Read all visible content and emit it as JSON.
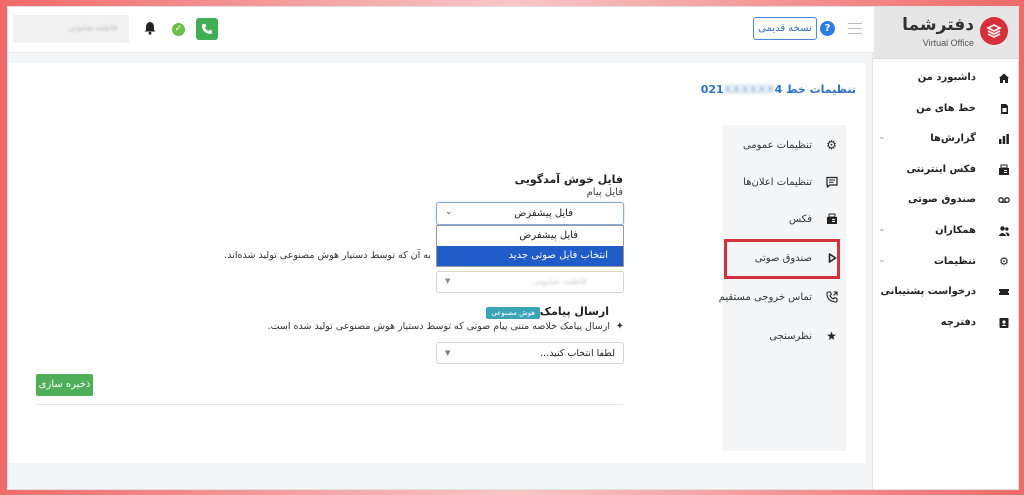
{
  "brand": {
    "name": "دفترشما",
    "subtitle": "Virtual Office",
    "accent": "#d8303a"
  },
  "sidebar": {
    "items": [
      {
        "label": "داشبورد من",
        "icon": "home-icon",
        "has_chevron": false
      },
      {
        "label": "خط های من",
        "icon": "sim-card-icon",
        "has_chevron": false
      },
      {
        "label": "گزارش‌ها",
        "icon": "chart-icon",
        "has_chevron": true
      },
      {
        "label": "فکس اینترنتی",
        "icon": "fax-icon",
        "has_chevron": false
      },
      {
        "label": "صندوق صوتی",
        "icon": "voicemail-icon",
        "has_chevron": false
      },
      {
        "label": "همکاران",
        "icon": "users-icon",
        "has_chevron": true
      },
      {
        "label": "تنظیمات",
        "icon": "gear-icon",
        "has_chevron": true
      },
      {
        "label": "درخواست پشتیبانی",
        "icon": "ticket-icon",
        "has_chevron": false
      },
      {
        "label": "دفترچه",
        "icon": "contact-book-icon",
        "has_chevron": false
      }
    ]
  },
  "topbar": {
    "old_version_label": "نسخه قدیمی",
    "help_label": "?",
    "user_placeholder": "قاطمه صابونی"
  },
  "page": {
    "title_prefix": "تنظیمات خط",
    "title_number_visible": "021",
    "title_number_blurred": "XXXXXX",
    "title_number_end": "4"
  },
  "settings_menu": {
    "items": [
      {
        "label": "تنظیمات عمومی",
        "icon": "gear-icon"
      },
      {
        "label": "تنظیمات اعلان‌ها",
        "icon": "message-icon"
      },
      {
        "label": "فکس",
        "icon": "fax-icon"
      },
      {
        "label": "صندوق صوتی",
        "icon": "play-icon"
      },
      {
        "label": "تماس خروجی مستقیم",
        "icon": "phone-forward-icon"
      },
      {
        "label": "نظرسنجی",
        "icon": "star-icon"
      }
    ],
    "highlighted_index": 3,
    "highlight_color": "#d2323f"
  },
  "form": {
    "welcome_title": "فایل خوش آمدگویی",
    "voice_label": "فایل پیام",
    "welcome_select_value": "فایل پیشفرض",
    "dropdown_options": [
      "فایل پیشفرض",
      "انتخاب فایل صوتی جدید"
    ],
    "dropdown_selected_index": 1,
    "ai_description": "به آن که توسط دستیار هوش مصنوعی تولید شده‌اند.",
    "blurred_select_value": "فاطمه صابونی",
    "sms_title": "ارسال پیامک",
    "ai_badge": "هوش مصنوعی",
    "sms_description": "ارسال پیامک خلاصه متنی پیام صوتی که توسط دستیار هوش مصنوعی تولید شده است.",
    "sms_select_placeholder": "لطفا انتخاب کنید...",
    "save_label": "ذخیره سازی"
  }
}
